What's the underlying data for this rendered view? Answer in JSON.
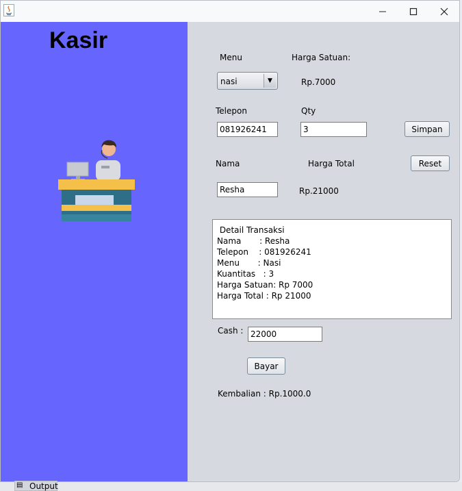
{
  "window": {
    "controls": {
      "minimize": "minimize-icon",
      "maximize": "maximize-icon",
      "close": "close-icon"
    }
  },
  "left": {
    "title": "Kasir",
    "image": "cashier-illustration"
  },
  "form": {
    "menu_label": "Menu",
    "menu_selected": "nasi",
    "harga_satuan_label": "Harga Satuan:",
    "harga_satuan_value": "Rp.7000",
    "telepon_label": "Telepon",
    "telepon_value": "081926241",
    "qty_label": "Qty",
    "qty_value": "3",
    "simpan_label": "Simpan",
    "nama_label": "Nama",
    "nama_value": "Resha",
    "harga_total_label": "Harga Total",
    "harga_total_value": "Rp.21000",
    "reset_label": "Reset",
    "detail_lines": [
      " Detail Transaksi",
      "Nama       : Resha",
      "Telepon    : 081926241",
      "Menu       : Nasi",
      "Kuantitas   : 3",
      "Harga Satuan: Rp 7000",
      "Harga Total : Rp 21000"
    ],
    "cash_label": "Cash :",
    "cash_value": "22000",
    "bayar_label": "Bayar",
    "kembalian_text": "Kembalian : Rp.1000.0"
  },
  "taskbar": {
    "output_label": "Output"
  },
  "colors": {
    "left_panel": "#6666ff",
    "right_panel": "#d6d9df"
  }
}
